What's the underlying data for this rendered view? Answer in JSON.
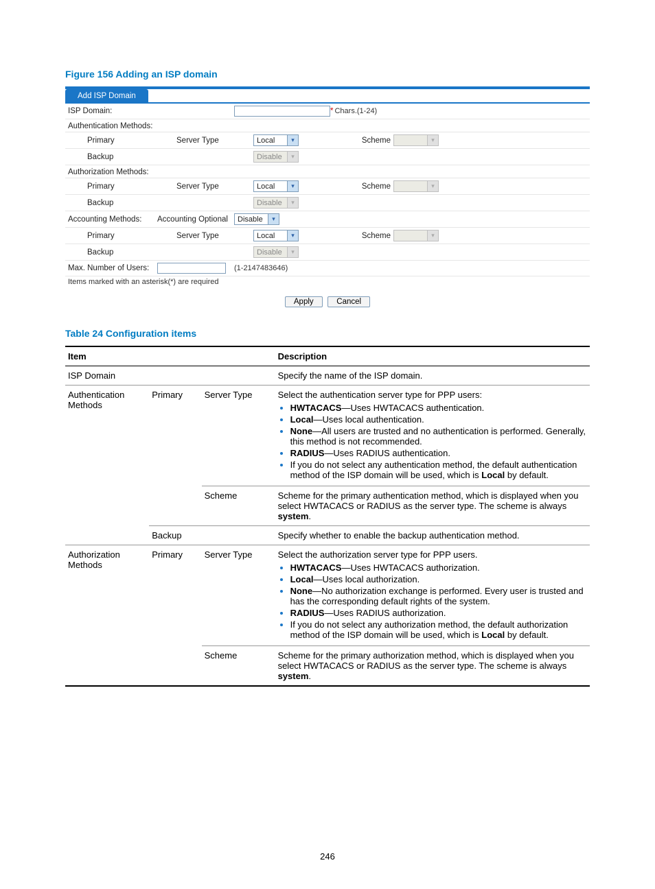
{
  "figure": {
    "caption": "Figure 156 Adding an ISP domain"
  },
  "form": {
    "tab": "Add ISP Domain",
    "isp_domain_label": "ISP Domain:",
    "isp_domain_hint": "Chars.(1-24)",
    "auth_section": "Authentication Methods:",
    "authz_section": "Authorization Methods:",
    "acct_section": "Accounting Methods:",
    "acct_optional_label": "Accounting Optional",
    "primary": "Primary",
    "backup": "Backup",
    "server_type": "Server Type",
    "scheme": "Scheme",
    "local_val": "Local",
    "disable_val": "Disable",
    "max_users_label": "Max. Number of Users:",
    "max_users_hint": "(1-2147483646)",
    "required_note": "Items marked with an asterisk(*) are required",
    "apply": "Apply",
    "cancel": "Cancel"
  },
  "table": {
    "caption": "Table 24 Configuration items",
    "head_item": "Item",
    "head_desc": "Description",
    "rows": {
      "isp_domain": {
        "item": "ISP Domain",
        "desc": "Specify the name of the ISP domain."
      },
      "auth": {
        "item": "Authentication Methods",
        "primary": "Primary",
        "server_type": "Server Type",
        "scheme": "Scheme",
        "backup": "Backup",
        "st_intro": "Select the authentication server type for PPP users:",
        "st_b1a": "HWTACACS",
        "st_b1b": "—Uses HWTACACS authentication.",
        "st_b2a": "Local",
        "st_b2b": "—Uses local authentication.",
        "st_b3a": "None",
        "st_b3b": "—All users are trusted and no authentication is performed. Generally, this method is not recommended.",
        "st_b4a": "RADIUS",
        "st_b4b": "—Uses RADIUS authentication.",
        "st_b5a": "If you do not select any authentication method, the default authentication method of the ISP domain will be used, which is ",
        "st_b5b": "Local",
        "st_b5c": " by default.",
        "scheme_desc_a": "Scheme for the primary authentication method, which is displayed when you select HWTACACS or RADIUS as the server type. The scheme is always ",
        "scheme_desc_b": "system",
        "scheme_desc_c": ".",
        "backup_desc": "Specify whether to enable the backup authentication method."
      },
      "authz": {
        "item": "Authorization Methods",
        "primary": "Primary",
        "server_type": "Server Type",
        "scheme": "Scheme",
        "st_intro": "Select the authorization server type for PPP users.",
        "st_b1a": "HWTACACS",
        "st_b1b": "—Uses HWTACACS authorization.",
        "st_b2a": "Local",
        "st_b2b": "—Uses local authorization.",
        "st_b3a": "None",
        "st_b3b": "—No authorization exchange is performed. Every user is trusted and has the corresponding default rights of the system.",
        "st_b4a": "RADIUS",
        "st_b4b": "—Uses RADIUS authorization.",
        "st_b5a": "If you do not select any authorization method, the default authorization method of the ISP domain will be used, which is ",
        "st_b5b": "Local",
        "st_b5c": " by default.",
        "scheme_desc_a": "Scheme for the primary authorization method, which is displayed when you select HWTACACS or RADIUS as the server type. The scheme is always ",
        "scheme_desc_b": "system",
        "scheme_desc_c": "."
      }
    }
  },
  "page_number": "246"
}
